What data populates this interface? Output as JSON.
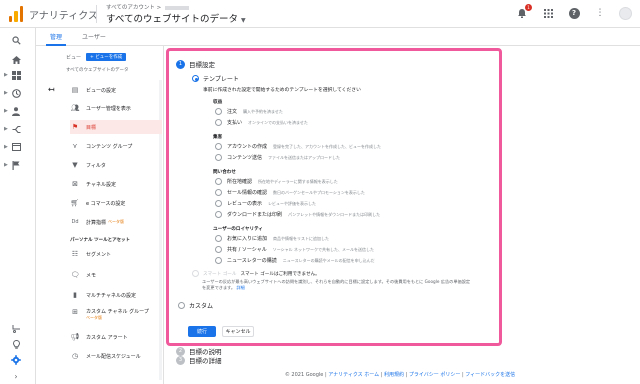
{
  "header": {
    "app_name": "アナリティクス",
    "breadcrumb_small": "すべてのアカウント > ",
    "breadcrumb_main": "すべてのウェブサイトのデータ",
    "notifications_count": "1"
  },
  "tabs": {
    "admin": "管理",
    "user": "ユーザー"
  },
  "view_column": {
    "label": "ビュー",
    "create_view": "+ ビューを作成",
    "view_name": "すべてのウェブサイトのデータ",
    "items": [
      {
        "label": "ビューの設定",
        "icon": "document-icon"
      },
      {
        "label": "ユーザー管理を表示",
        "icon": "users-icon"
      },
      {
        "label": "目標",
        "icon": "flag-icon"
      },
      {
        "label": "コンテンツ グループ",
        "icon": "content-group-icon"
      },
      {
        "label": "フィルタ",
        "icon": "filter-icon"
      },
      {
        "label": "チャネル設定",
        "icon": "channel-icon"
      },
      {
        "label": "e コマースの設定",
        "icon": "cart-icon"
      },
      {
        "label": "計算指標",
        "icon": "calculated-metric-icon",
        "badge": "ベータ版"
      }
    ],
    "section_title": "パーソナル ツールとアセット",
    "personal_items": [
      {
        "label": "セグメント",
        "icon": "segment-icon"
      },
      {
        "label": "メモ",
        "icon": "memo-icon"
      },
      {
        "label": "マルチチャネルの設定",
        "icon": "bar-chart-icon"
      },
      {
        "label": "カスタム チャネル グループ",
        "icon": "custom-channel-icon",
        "badge": "ベータ版"
      },
      {
        "label": "カスタム アラート",
        "icon": "megaphone-icon"
      },
      {
        "label": "メール配信スケジュール",
        "icon": "clock-icon"
      }
    ]
  },
  "goal_setup": {
    "step1_num": "1",
    "step1_title": "目標設定",
    "template_label": "テンプレート",
    "template_desc": "事前に作成された設定で開始するためのテンプレートを選択してください",
    "groups": [
      {
        "title": "収益",
        "options": [
          {
            "label": "注文",
            "desc": "購入や予約を済ませた"
          },
          {
            "label": "支払い",
            "desc": "オンラインでの支払いを済ませた"
          }
        ]
      },
      {
        "title": "集客",
        "options": [
          {
            "label": "アカウントの作成",
            "desc": "登録を完了した、アカウントを作成した、ビューを作成した"
          },
          {
            "label": "コンテンツ送信",
            "desc": "ファイルを送信またはアップロードした"
          }
        ]
      },
      {
        "title": "問い合わせ",
        "options": [
          {
            "label": "所在地確認",
            "desc": "所在地やディーラーに関する情報を表示した"
          },
          {
            "label": "セール情報の確認",
            "desc": "数日のバーゲンセールやプロモーションを表示した"
          },
          {
            "label": "レビューの表示",
            "desc": "レビューや評価を表示した"
          },
          {
            "label": "ダウンロードまたは印刷",
            "desc": "パンフレットや情報をダウンロードまたは印刷した"
          }
        ]
      },
      {
        "title": "ユーザーのロイヤリティ",
        "options": [
          {
            "label": "お気に入りに追加",
            "desc": "商品や情報をリストに追加した"
          },
          {
            "label": "共有 / ソーシャル",
            "desc": "ソーシャル ネットワークで共有した、メールを送信した"
          },
          {
            "label": "ニュースレターの購読",
            "desc": "ニュースレターの購読やメールの配信を申し込んだ"
          }
        ]
      }
    ],
    "smart_goal_label": "スマート ゴール",
    "smart_goal_note": "スマート ゴールはご利用できません。",
    "smart_goal_desc": "ユーザーの反応が最も高いウェブサイトへの訪問を識別し、それらを自動的に目標に設定します。その後費用をもとに Google 広告の単価設定を変更できます。",
    "smart_goal_link": "詳細",
    "custom_label": "カスタム",
    "continue_button": "続行",
    "cancel_button": "キャンセル",
    "step2_num": "2",
    "step2_title": "目標の説明",
    "step3_num": "3",
    "step3_title": "目標の詳細"
  },
  "footer": {
    "copyright": "© 2021 Google",
    "links": [
      "アナリティクス ホーム",
      "利用規約",
      "プライバシー ポリシー",
      "フィードバックを送信"
    ]
  }
}
